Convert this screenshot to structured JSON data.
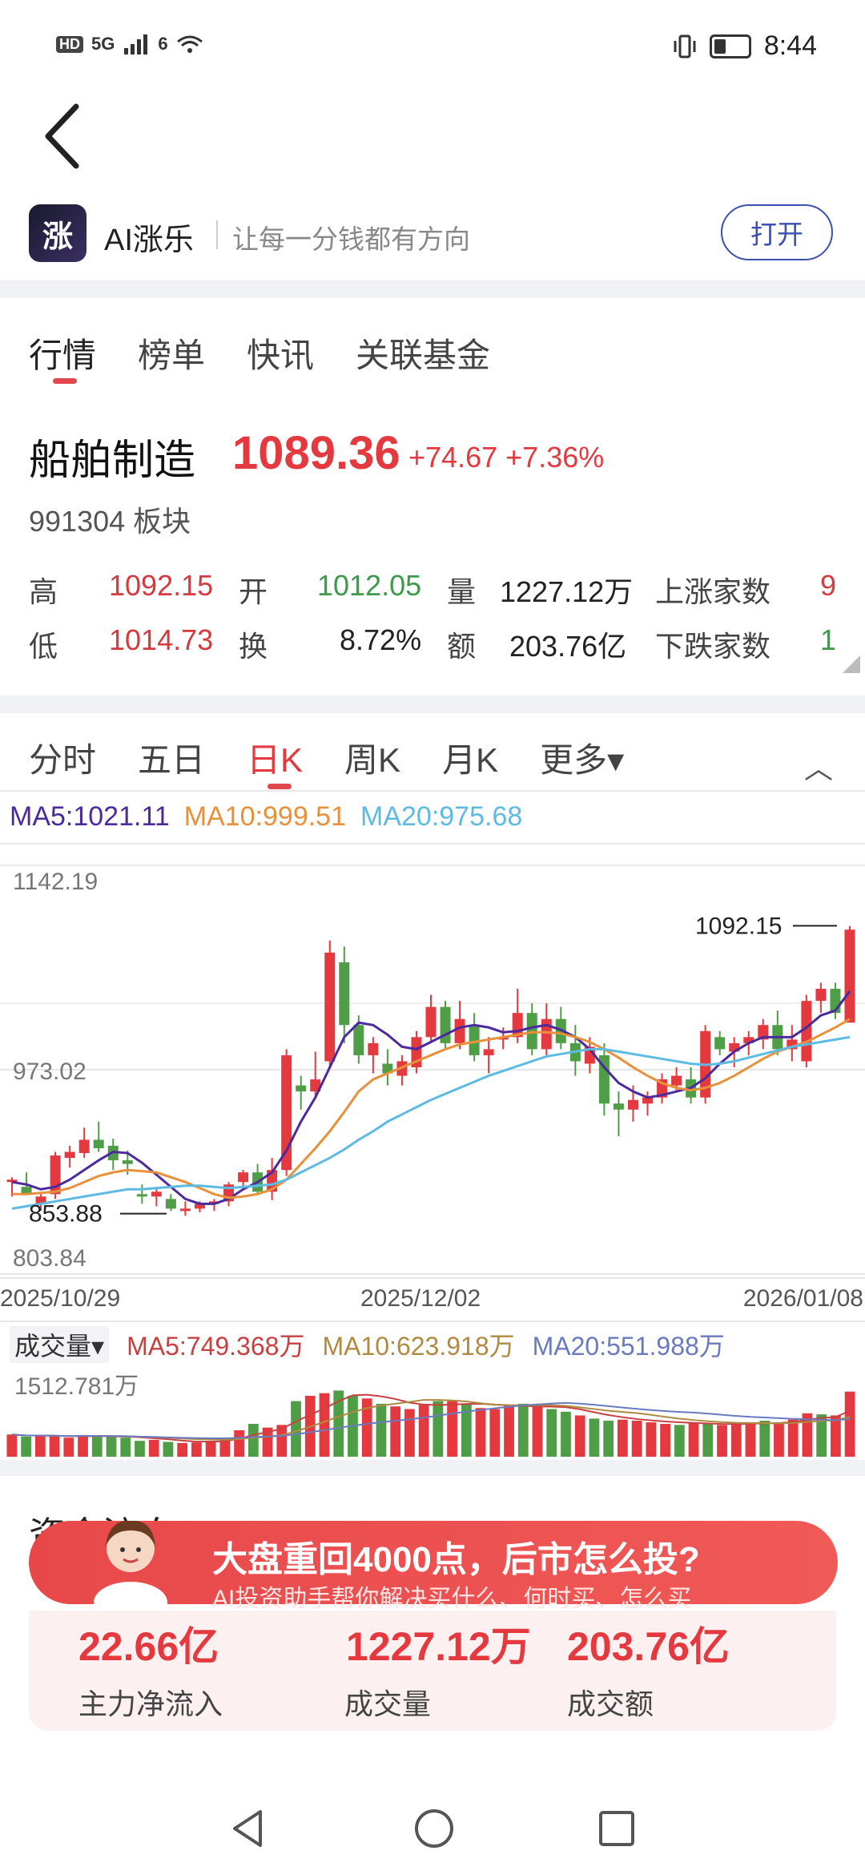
{
  "status": {
    "left": [
      "HD",
      "5G",
      "6"
    ],
    "time": "8:44"
  },
  "app": {
    "logo_text": "涨",
    "name": "AI涨乐",
    "slogan": "让每一分钱都有方向",
    "open_label": "打开"
  },
  "tabs": [
    "行情",
    "榜单",
    "快讯",
    "关联基金"
  ],
  "stock": {
    "name": "船舶制造",
    "price": "1089.36",
    "change": "+74.67",
    "change_pct": "+7.36%",
    "code": "991304",
    "type": "板块"
  },
  "stats": {
    "high_label": "高",
    "high": "1092.15",
    "open_label": "开",
    "open": "1012.05",
    "volume_label": "量",
    "volume": "1227.12万",
    "up_label": "上涨家数",
    "up": "9",
    "low_label": "低",
    "low": "1014.73",
    "turnover_label": "换",
    "turnover": "8.72%",
    "amount_label": "额",
    "amount": "203.76亿",
    "down_label": "下跌家数",
    "down": "1"
  },
  "ktabs": {
    "items": [
      "分时",
      "五日",
      "日K",
      "周K",
      "月K"
    ],
    "more": "更多▾",
    "collapse": "︿"
  },
  "ma": {
    "ma5": "MA5:1021.11",
    "ma10": "MA10:999.51",
    "ma20": "MA20:975.68"
  },
  "colors": {
    "up": "#e3393f",
    "down": "#4f9e47",
    "ma5": "#4b2a9e",
    "ma10": "#e8903a",
    "ma20": "#5dbbe3"
  },
  "chart_data": {
    "type": "candlestick",
    "y_ticks": [
      "1142.19",
      "973.02",
      "803.84"
    ],
    "ylim": [
      803.84,
      1142.19
    ],
    "x_labels": [
      "2025/10/29",
      "2025/12/02",
      "2026/01/08"
    ],
    "max_label": "1092.15",
    "min_label": "853.88",
    "candles": [
      [
        880,
        884,
        868,
        882
      ],
      [
        876,
        888,
        872,
        870
      ],
      [
        862,
        870,
        856,
        868
      ],
      [
        870,
        905,
        866,
        902
      ],
      [
        900,
        910,
        892,
        905
      ],
      [
        904,
        925,
        900,
        915
      ],
      [
        915,
        930,
        905,
        908
      ],
      [
        910,
        916,
        890,
        898
      ],
      [
        898,
        906,
        886,
        895
      ],
      [
        870,
        878,
        862,
        868
      ],
      [
        868,
        874,
        860,
        872
      ],
      [
        866,
        870,
        856,
        858
      ],
      [
        856,
        864,
        852,
        858
      ],
      [
        858,
        864,
        855,
        862
      ],
      [
        862,
        866,
        856,
        864
      ],
      [
        864,
        880,
        860,
        878
      ],
      [
        880,
        890,
        875,
        888
      ],
      [
        888,
        895,
        870,
        872
      ],
      [
        872,
        900,
        865,
        890
      ],
      [
        890,
        990,
        885,
        985
      ],
      [
        960,
        968,
        940,
        955
      ],
      [
        955,
        988,
        950,
        965
      ],
      [
        980,
        1080,
        975,
        1070
      ],
      [
        1062,
        1075,
        995,
        1010
      ],
      [
        1010,
        1018,
        978,
        985
      ],
      [
        985,
        1000,
        970,
        995
      ],
      [
        978,
        990,
        960,
        970
      ],
      [
        968,
        985,
        960,
        980
      ],
      [
        975,
        1005,
        970,
        1000
      ],
      [
        1000,
        1035,
        995,
        1025
      ],
      [
        1025,
        1030,
        990,
        995
      ],
      [
        995,
        1030,
        990,
        1015
      ],
      [
        1010,
        1020,
        980,
        985
      ],
      [
        985,
        1000,
        970,
        990
      ],
      [
        998,
        1008,
        990,
        1000
      ],
      [
        1000,
        1040,
        995,
        1020
      ],
      [
        1020,
        1028,
        985,
        990
      ],
      [
        990,
        1028,
        985,
        1015
      ],
      [
        1015,
        1025,
        990,
        995
      ],
      [
        995,
        1010,
        968,
        980
      ],
      [
        978,
        1000,
        970,
        992
      ],
      [
        985,
        995,
        935,
        945
      ],
      [
        945,
        955,
        918,
        940
      ],
      [
        940,
        960,
        930,
        948
      ],
      [
        945,
        955,
        935,
        950
      ],
      [
        950,
        970,
        945,
        965
      ],
      [
        960,
        975,
        955,
        968
      ],
      [
        965,
        975,
        945,
        950
      ],
      [
        950,
        1010,
        945,
        1005
      ],
      [
        1000,
        1005,
        985,
        990
      ],
      [
        988,
        1000,
        975,
        995
      ],
      [
        995,
        1005,
        985,
        1000
      ],
      [
        998,
        1015,
        990,
        1010
      ],
      [
        1010,
        1022,
        985,
        990
      ],
      [
        990,
        1010,
        980,
        998
      ],
      [
        980,
        1035,
        975,
        1030
      ],
      [
        1030,
        1045,
        1020,
        1040
      ],
      [
        1040,
        1045,
        1015,
        1020
      ],
      [
        1012,
        1092,
        1014,
        1089
      ]
    ],
    "ma5": [
      880,
      878,
      874,
      876,
      882,
      890,
      898,
      905,
      904,
      896,
      886,
      876,
      866,
      862,
      862,
      866,
      874,
      880,
      888,
      906,
      930,
      950,
      975,
      1000,
      1012,
      1010,
      1002,
      992,
      990,
      996,
      1002,
      1008,
      1010,
      1008,
      1004,
      1005,
      1008,
      1010,
      1006,
      1000,
      990,
      975,
      962,
      955,
      950,
      952,
      955,
      958,
      966,
      978,
      988,
      995,
      1000,
      1000,
      1000,
      1008,
      1018,
      1022,
      1038
    ],
    "ma10": [
      870,
      870,
      871,
      872,
      875,
      880,
      885,
      888,
      890,
      889,
      888,
      884,
      880,
      875,
      870,
      867,
      868,
      870,
      874,
      882,
      895,
      908,
      922,
      938,
      955,
      965,
      970,
      975,
      980,
      985,
      990,
      994,
      996,
      998,
      1000,
      1002,
      1004,
      1004,
      1003,
      1000,
      996,
      990,
      983,
      975,
      968,
      962,
      958,
      956,
      958,
      962,
      968,
      975,
      982,
      988,
      992,
      996,
      1002,
      1008,
      1015
    ],
    "ma20": [
      858,
      860,
      862,
      864,
      866,
      868,
      870,
      872,
      874,
      874,
      875,
      876,
      877,
      877,
      876,
      875,
      876,
      877,
      878,
      882,
      888,
      894,
      900,
      907,
      915,
      922,
      930,
      936,
      942,
      948,
      953,
      958,
      963,
      968,
      972,
      976,
      980,
      984,
      986,
      988,
      990,
      990,
      988,
      986,
      984,
      982,
      980,
      978,
      977,
      978,
      980,
      983,
      986,
      989,
      992,
      994,
      996,
      998,
      1000
    ]
  },
  "volume": {
    "label": "成交量▾",
    "ma5": "MA5:749.368万",
    "ma10": "MA10:623.918万",
    "ma20": "MA20:551.988万",
    "max": "1512.781万",
    "values": [
      420,
      380,
      400,
      390,
      360,
      410,
      380,
      390,
      360,
      300,
      320,
      280,
      260,
      270,
      300,
      360,
      500,
      620,
      550,
      600,
      1050,
      1150,
      1200,
      1250,
      1150,
      1100,
      1000,
      950,
      900,
      980,
      1050,
      1050,
      1000,
      920,
      900,
      980,
      1000,
      950,
      900,
      850,
      780,
      720,
      680,
      700,
      680,
      650,
      620,
      600,
      650,
      620,
      600,
      610,
      640,
      680,
      650,
      700,
      820,
      800,
      780,
      1230
    ]
  },
  "flow": {
    "title": "资金流向",
    "main_val": "22.66亿",
    "main_label": "主力净流入",
    "vol_val": "1227.12万",
    "vol_label": "成交量",
    "amt_val": "203.76亿",
    "amt_label": "成交额"
  },
  "promo": {
    "title": "大盘重回4000点，后市怎么投?",
    "sub": "AI投资助手帮你解决买什么、何时买、怎么买"
  },
  "nav": {
    "back": "back-nav-icon",
    "home": "home-nav-icon",
    "recent": "recent-nav-icon"
  }
}
